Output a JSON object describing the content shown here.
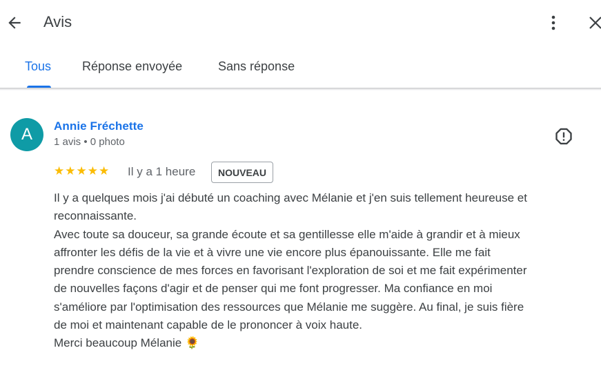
{
  "header": {
    "title": "Avis",
    "back_icon": "arrow-back-icon",
    "more_icon": "more-vert-icon",
    "close_icon": "close-icon"
  },
  "tabs": [
    {
      "label": "Tous",
      "active": true
    },
    {
      "label": "Réponse envoyée",
      "active": false
    },
    {
      "label": "Sans réponse",
      "active": false
    }
  ],
  "review": {
    "avatar_letter": "A",
    "avatar_color": "#0f9ba6",
    "author": "Annie Fréchette",
    "meta": "1 avis • 0 photo",
    "stars": "★★★★★",
    "rating": 5,
    "time": "Il y a 1 heure",
    "badge": "NOUVEAU",
    "report_icon": "report-icon",
    "text_lines": [
      "Il y a quelques mois j'ai débuté un coaching avec Mélanie et j'en suis tellement heureuse et",
      "reconnaissante.",
      "Avec toute sa douceur, sa grande écoute et sa gentillesse elle m'aide à grandir et à mieux",
      "affronter les défis de la vie et à vivre une vie encore plus épanouissante. Elle me fait",
      "prendre conscience de mes forces en favorisant l'exploration de soi et me fait expérimenter",
      "de nouvelles façons d'agir et de penser qui me font progresser. Ma confiance en moi",
      "s'améliore par l'optimisation des ressources que Mélanie me suggère. Au final, je suis fière",
      "de moi et maintenant capable de le prononcer à voix haute.",
      "Merci beaucoup Mélanie 🌻"
    ]
  },
  "colors": {
    "accent": "#1a73e8",
    "star": "#fbbc04",
    "secondary_text": "#5f6368"
  }
}
